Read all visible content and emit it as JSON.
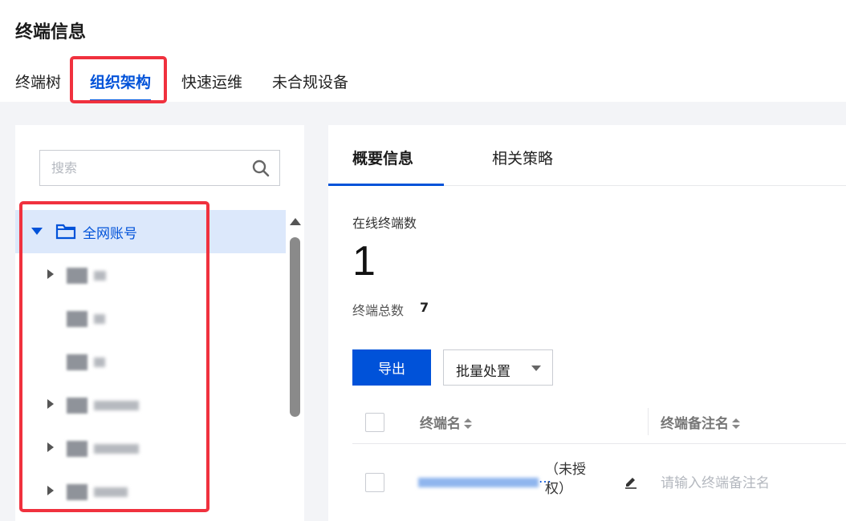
{
  "page": {
    "title": "终端信息",
    "tabs": [
      {
        "label": "终端树"
      },
      {
        "label": "组织架构"
      },
      {
        "label": "快速运维"
      },
      {
        "label": "未合规设备"
      }
    ],
    "active_tab": "组织架构"
  },
  "tree": {
    "search_placeholder": "搜索",
    "root_label": "全网账号"
  },
  "detail": {
    "tabs": [
      {
        "label": "概要信息"
      },
      {
        "label": "相关策略"
      }
    ],
    "online_label": "在线终端数",
    "online_count": "1",
    "total_label": "终端总数",
    "total_value": "7",
    "export_label": "导出",
    "batch_label": "批量处置",
    "columns": {
      "name": "终端名",
      "remark": "终端备注名"
    },
    "row": {
      "ellipsis": "…",
      "status": "（未授权）",
      "remark_placeholder": "请输入终端备注名"
    }
  },
  "colors": {
    "accent": "#0052d9",
    "highlight": "#f0313e",
    "selected_bg": "#dce8fb"
  }
}
